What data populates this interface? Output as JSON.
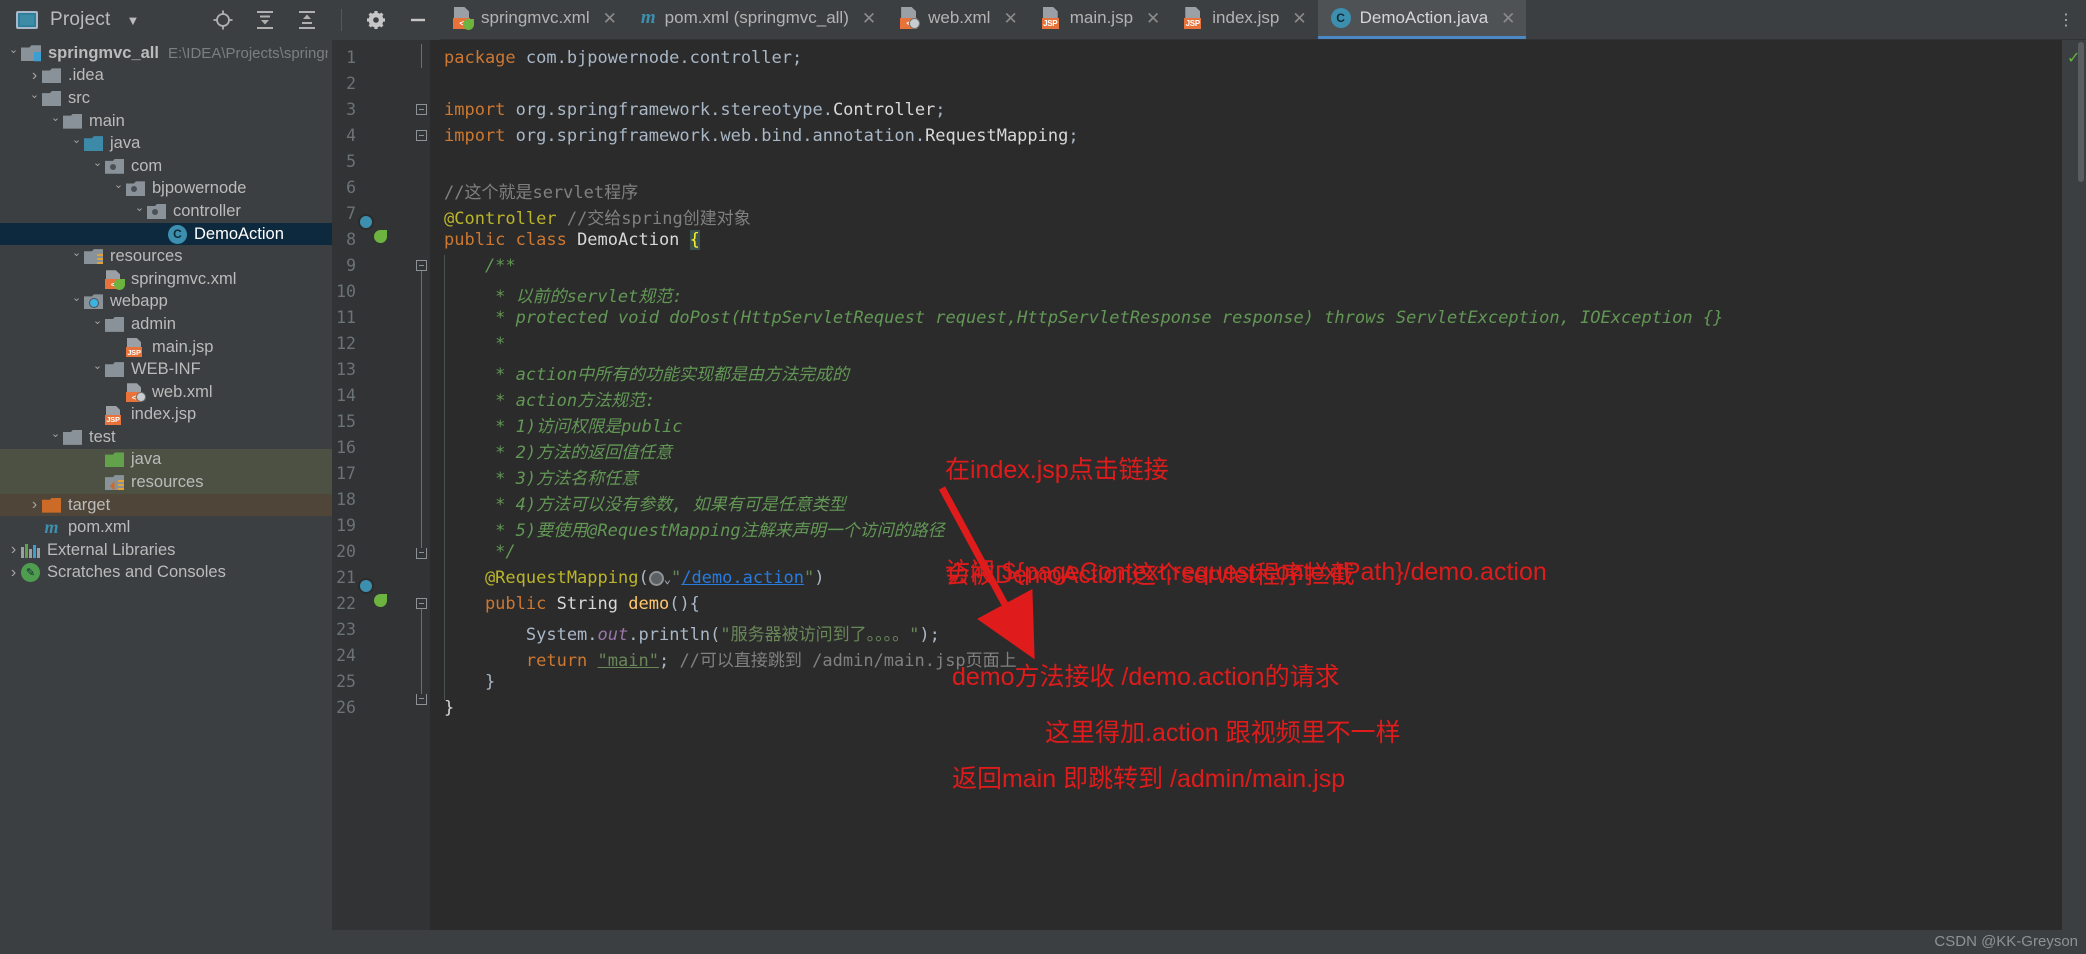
{
  "window": {
    "project_panel_title": "Project",
    "watermark": "CSDN @KK-Greyson"
  },
  "toolbar": {
    "locate_icon": "crosshair-icon",
    "expand_icon": "expand-all-icon",
    "collapse_icon": "collapse-all-icon",
    "settings_icon": "gear-icon",
    "hide_icon": "minimize-icon",
    "more_icon": "more-vertical-icon"
  },
  "tabs": [
    {
      "label": "springmvc.xml",
      "icon": "xml-spring-file-icon",
      "badge": "<",
      "active": false
    },
    {
      "label": "pom.xml (springmvc_all)",
      "icon": "maven-file-icon",
      "badge": "m",
      "active": false
    },
    {
      "label": "web.xml",
      "icon": "xml-web-file-icon",
      "badge": "<",
      "active": false
    },
    {
      "label": "main.jsp",
      "icon": "jsp-file-icon",
      "badge": "JSP",
      "active": false
    },
    {
      "label": "index.jsp",
      "icon": "jsp-file-icon",
      "badge": "JSP",
      "active": false
    },
    {
      "label": "DemoAction.java",
      "icon": "java-class-icon",
      "badge": "C",
      "active": true
    }
  ],
  "sidebar": {
    "project_name": "springmvc_all",
    "project_path": "E:\\IDEA\\Projects\\springmvc_",
    "items": [
      {
        "label": ".idea",
        "indent": 1,
        "arrow": "right",
        "icon": "folder",
        "state": "normal"
      },
      {
        "label": "src",
        "indent": 1,
        "arrow": "down",
        "icon": "folder",
        "state": "normal"
      },
      {
        "label": "main",
        "indent": 2,
        "arrow": "down",
        "icon": "folder",
        "state": "normal"
      },
      {
        "label": "java",
        "indent": 3,
        "arrow": "down",
        "icon": "folder-source-blue",
        "state": "normal"
      },
      {
        "label": "com",
        "indent": 4,
        "arrow": "down",
        "icon": "package",
        "state": "normal"
      },
      {
        "label": "bjpowernode",
        "indent": 5,
        "arrow": "down",
        "icon": "package",
        "state": "normal"
      },
      {
        "label": "controller",
        "indent": 6,
        "arrow": "down",
        "icon": "package",
        "state": "normal"
      },
      {
        "label": "DemoAction",
        "indent": 7,
        "arrow": "none",
        "icon": "java-class",
        "state": "selected"
      },
      {
        "label": "resources",
        "indent": 3,
        "arrow": "down",
        "icon": "folder-resources",
        "state": "normal"
      },
      {
        "label": "springmvc.xml",
        "indent": 4,
        "arrow": "none",
        "icon": "xml-spring-file",
        "state": "normal"
      },
      {
        "label": "webapp",
        "indent": 3,
        "arrow": "down",
        "icon": "folder-web",
        "state": "normal"
      },
      {
        "label": "admin",
        "indent": 4,
        "arrow": "down",
        "icon": "folder",
        "state": "normal"
      },
      {
        "label": "main.jsp",
        "indent": 5,
        "arrow": "none",
        "icon": "jsp-file",
        "state": "normal"
      },
      {
        "label": "WEB-INF",
        "indent": 4,
        "arrow": "down",
        "icon": "folder",
        "state": "normal"
      },
      {
        "label": "web.xml",
        "indent": 5,
        "arrow": "none",
        "icon": "xml-web-file",
        "state": "normal"
      },
      {
        "label": "index.jsp",
        "indent": 4,
        "arrow": "none",
        "icon": "jsp-file",
        "state": "normal"
      },
      {
        "label": "test",
        "indent": 2,
        "arrow": "down",
        "icon": "folder",
        "state": "normal"
      },
      {
        "label": "java",
        "indent": 3,
        "arrow": "none",
        "icon": "folder-test-green",
        "state": "green"
      },
      {
        "label": "resources",
        "indent": 3,
        "arrow": "none",
        "icon": "folder-test-resources",
        "state": "green"
      },
      {
        "label": "target",
        "indent": 1,
        "arrow": "right",
        "icon": "folder-excluded-orange",
        "state": "brown"
      },
      {
        "label": "pom.xml",
        "indent": 1,
        "arrow": "none",
        "icon": "maven-file",
        "state": "normal"
      },
      {
        "label": "External Libraries",
        "indent": 0,
        "arrow": "right",
        "icon": "libraries",
        "state": "normal"
      },
      {
        "label": "Scratches and Consoles",
        "indent": 0,
        "arrow": "right",
        "icon": "scratches",
        "state": "normal"
      }
    ]
  },
  "editor": {
    "line_numbers": [
      "1",
      "2",
      "3",
      "4",
      "5",
      "6",
      "7",
      "8",
      "9",
      "10",
      "11",
      "12",
      "13",
      "14",
      "15",
      "16",
      "17",
      "18",
      "19",
      "20",
      "21",
      "22",
      "23",
      "24",
      "25",
      "26"
    ],
    "lines": [
      {
        "n": 1,
        "segments": [
          {
            "t": "package ",
            "c": "kw"
          },
          {
            "t": "com.bjpowernode.controller;",
            "c": "plain"
          }
        ]
      },
      {
        "n": 2,
        "segments": []
      },
      {
        "n": 3,
        "segments": [
          {
            "t": "import ",
            "c": "kw"
          },
          {
            "t": "org.springframework.stereotype.",
            "c": "plain"
          },
          {
            "t": "Controller",
            "c": "white"
          },
          {
            "t": ";",
            "c": "plain"
          }
        ]
      },
      {
        "n": 4,
        "segments": [
          {
            "t": "import ",
            "c": "kw"
          },
          {
            "t": "org.springframework.web.bind.annotation.",
            "c": "plain"
          },
          {
            "t": "RequestMapping",
            "c": "white"
          },
          {
            "t": ";",
            "c": "plain"
          }
        ]
      },
      {
        "n": 5,
        "segments": []
      },
      {
        "n": 6,
        "segments": [
          {
            "t": "//这个就是servlet程序",
            "c": "cmt"
          }
        ]
      },
      {
        "n": 7,
        "segments": [
          {
            "t": "@Controller",
            "c": "ann"
          },
          {
            "t": " //交给spring创建对象",
            "c": "cmt"
          }
        ]
      },
      {
        "n": 8,
        "segments": [
          {
            "t": "public class ",
            "c": "kw"
          },
          {
            "t": "DemoAction ",
            "c": "white"
          },
          {
            "t": "{",
            "c": "brace-hl"
          }
        ]
      },
      {
        "n": 9,
        "segments": [
          {
            "t": "    /**",
            "c": "doc"
          }
        ]
      },
      {
        "n": 10,
        "segments": [
          {
            "t": "     * 以前的servlet规范:",
            "c": "doc"
          }
        ]
      },
      {
        "n": 11,
        "segments": [
          {
            "t": "     * protected void doPost(HttpServletRequest request,HttpServletResponse response) throws ServletException, IOException {}",
            "c": "doc"
          }
        ]
      },
      {
        "n": 12,
        "segments": [
          {
            "t": "     *",
            "c": "doc"
          }
        ]
      },
      {
        "n": 13,
        "segments": [
          {
            "t": "     * action中所有的功能实现都是由方法完成的",
            "c": "doc"
          }
        ]
      },
      {
        "n": 14,
        "segments": [
          {
            "t": "     * action方法规范:",
            "c": "doc"
          }
        ]
      },
      {
        "n": 15,
        "segments": [
          {
            "t": "     * 1)访问权限是public",
            "c": "doc"
          }
        ]
      },
      {
        "n": 16,
        "segments": [
          {
            "t": "     * 2)方法的返回值任意",
            "c": "doc"
          }
        ]
      },
      {
        "n": 17,
        "segments": [
          {
            "t": "     * 3)方法名称任意",
            "c": "doc"
          }
        ]
      },
      {
        "n": 18,
        "segments": [
          {
            "t": "     * 4)方法可以没有参数, 如果有可是任意类型",
            "c": "doc"
          }
        ]
      },
      {
        "n": 19,
        "segments": [
          {
            "t": "     * 5)要使用@RequestMapping注解来声明一个访问的路径",
            "c": "doc"
          }
        ]
      },
      {
        "n": 20,
        "segments": [
          {
            "t": "     */",
            "c": "doc"
          }
        ]
      },
      {
        "n": 21,
        "segments": [
          {
            "t": "    @RequestMapping",
            "c": "ann"
          },
          {
            "t": "(",
            "c": "plain"
          }
        ]
      },
      {
        "n": 22,
        "segments": [
          {
            "t": "    public ",
            "c": "kw"
          },
          {
            "t": "String ",
            "c": "white"
          },
          {
            "t": "demo",
            "c": "meth"
          },
          {
            "t": "(){",
            "c": "plain"
          }
        ]
      },
      {
        "n": 23,
        "segments": [
          {
            "t": "        System.",
            "c": "plain"
          },
          {
            "t": "out",
            "c": "fld"
          },
          {
            "t": ".println(",
            "c": "plain"
          },
          {
            "t": "\"服务器被访问到了。。。。\"",
            "c": "str"
          },
          {
            "t": ");",
            "c": "plain"
          }
        ]
      },
      {
        "n": 24,
        "segments": [
          {
            "t": "        return ",
            "c": "kw"
          },
          {
            "t": "\"main\"",
            "c": "str"
          },
          {
            "t": "; ",
            "c": "plain"
          },
          {
            "t": "//可以直接跳到 /admin/main.jsp页面上",
            "c": "cmt"
          }
        ]
      },
      {
        "n": 25,
        "segments": [
          {
            "t": "    }",
            "c": "plain"
          }
        ]
      },
      {
        "n": 26,
        "segments": [
          {
            "t": "}",
            "c": "white"
          }
        ]
      }
    ],
    "line21_mapping_value": "\"/demo.action\"",
    "line21_mapping_string_open": "\"",
    "line21_mapping_link": "/demo.action",
    "line21_mapping_close": "\")"
  },
  "annotations": {
    "color": "#e01b1b",
    "block1": [
      "在index.jsp点击链接",
      "访问 ${pageContext.request.contextPath}/demo.action"
    ],
    "block2": [
      "会被DemoAction这个servlet程序拦截",
      " demo方法接收 /demo.action的请求",
      " 返回main 即跳转到 /admin/main.jsp"
    ],
    "block3": [
      "这里得加.action 跟视频里不一样"
    ]
  }
}
